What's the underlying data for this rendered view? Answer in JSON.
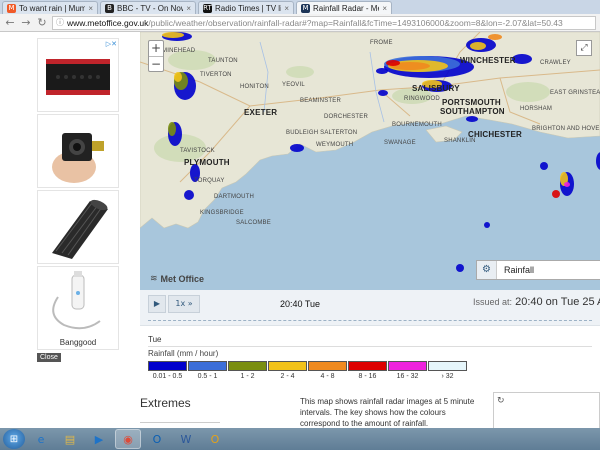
{
  "browser": {
    "tabs": [
      {
        "title": "To want rain | Mumsnet",
        "favicon": "mumsnet-icon",
        "color": "#f05a28",
        "glyph": "M",
        "active": false
      },
      {
        "title": "BBC - TV - On Now",
        "favicon": "bbc-icon",
        "color": "#222222",
        "glyph": "B",
        "active": false
      },
      {
        "title": "Radio Times | TV listings",
        "favicon": "radio-times-icon",
        "color": "#111111",
        "glyph": "RT",
        "active": false
      },
      {
        "title": "Rainfall Radar - Met Office",
        "favicon": "met-office-icon",
        "color": "#1d3557",
        "glyph": "M",
        "active": true
      }
    ],
    "url_host": "www.metoffice.gov.uk",
    "url_rest": "/public/weather/observation/rainfall-radar#?map=Rainfall&fcTime=1493106000&zoom=8&lon=-2.07&lat=50.43"
  },
  "ads": {
    "adchoices_glyph": "▷✕",
    "brand": "Banggood",
    "close": "Close"
  },
  "map": {
    "zoom_in": "+",
    "zoom_out": "−",
    "fullscreen_glyph": "⤢",
    "places": [
      {
        "name": "EXETER",
        "big": true
      },
      {
        "name": "PLYMOUTH",
        "big": true
      },
      {
        "name": "SOUTHAMPTON",
        "big": true
      },
      {
        "name": "PORTSMOUTH",
        "big": true
      },
      {
        "name": "SALISBURY",
        "big": true
      },
      {
        "name": "WINCHESTER",
        "big": true
      },
      {
        "name": "CHICHESTER",
        "big": true
      },
      {
        "name": "BRIGHTON AND HOVE",
        "big": false
      },
      {
        "name": "EAST GRINSTEAD",
        "big": false
      },
      {
        "name": "TAUNTON",
        "big": false
      },
      {
        "name": "MINEHEAD",
        "big": false
      },
      {
        "name": "YEOVIL",
        "big": false
      },
      {
        "name": "DORCHESTER",
        "big": false
      },
      {
        "name": "WEYMOUTH",
        "big": false
      },
      {
        "name": "BUDLEIGH SALTERTON",
        "big": false
      },
      {
        "name": "HONITON",
        "big": false
      },
      {
        "name": "TIVERTON",
        "big": false
      },
      {
        "name": "TORQUAY",
        "big": false
      },
      {
        "name": "DARTMOUTH",
        "big": false
      },
      {
        "name": "KINGSBRIDGE",
        "big": false
      },
      {
        "name": "SALCOMBE",
        "big": false
      },
      {
        "name": "TAVISTOCK",
        "big": false
      },
      {
        "name": "BEAMINSTER",
        "big": false
      },
      {
        "name": "BOURNEMOUTH",
        "big": false
      },
      {
        "name": "RINGWOOD",
        "big": false
      },
      {
        "name": "CRAWLEY",
        "big": false
      },
      {
        "name": "HORSHAM",
        "big": false
      },
      {
        "name": "SWANAGE",
        "big": false
      },
      {
        "name": "SHANKLIN",
        "big": false
      },
      {
        "name": "FROME",
        "big": false
      }
    ],
    "logo_text": "Met Office",
    "logo_glyph": "≋",
    "layer_label": "Rainfall",
    "layer_gear_glyph": "⚙"
  },
  "player": {
    "play_glyph": "▶",
    "speed_label": "1x »",
    "current_time": "20:40 Tue",
    "issued_label": "Issued at:",
    "issued_value": "20:40 on Tue 25 A"
  },
  "key": {
    "day": "Tue",
    "title": "Rainfall (mm / hour)",
    "bands": [
      {
        "label": "0.01 - 0.5",
        "color": "#0000cc"
      },
      {
        "label": "0.5 - 1",
        "color": "#3c6ed8"
      },
      {
        "label": "1 - 2",
        "color": "#7a8e10"
      },
      {
        "label": "2 - 4",
        "color": "#f2c21a"
      },
      {
        "label": "4 - 8",
        "color": "#ef8a1f"
      },
      {
        "label": "8 - 16",
        "color": "#dd0000"
      },
      {
        "label": "16 - 32",
        "color": "#ee22dd"
      },
      {
        "label": "› 32",
        "color": "#e6f6fb"
      }
    ]
  },
  "content": {
    "extremes_title": "Extremes",
    "description": "This map shows rainfall radar images at 5 minute intervals. The key shows how the colours correspond to the amount of rainfall.",
    "refresh_glyph": "↻"
  },
  "taskbar": {
    "start_glyph": "⊞",
    "items": [
      {
        "name": "ie-icon",
        "glyph": "e",
        "color": "#1e73c8",
        "active": false
      },
      {
        "name": "explorer-icon",
        "glyph": "▤",
        "color": "#e0b84a",
        "active": false
      },
      {
        "name": "media-player-icon",
        "glyph": "▶",
        "color": "#1e73c8",
        "active": false
      },
      {
        "name": "chrome-icon",
        "glyph": "◉",
        "color": "#dd4b39",
        "active": true
      },
      {
        "name": "outlook-icon",
        "glyph": "O",
        "color": "#0b5fb3",
        "active": false
      },
      {
        "name": "word-icon",
        "glyph": "W",
        "color": "#2b579a",
        "active": false
      },
      {
        "name": "outlook-2010-icon",
        "glyph": "O",
        "color": "#e3a21a",
        "active": false
      }
    ]
  }
}
